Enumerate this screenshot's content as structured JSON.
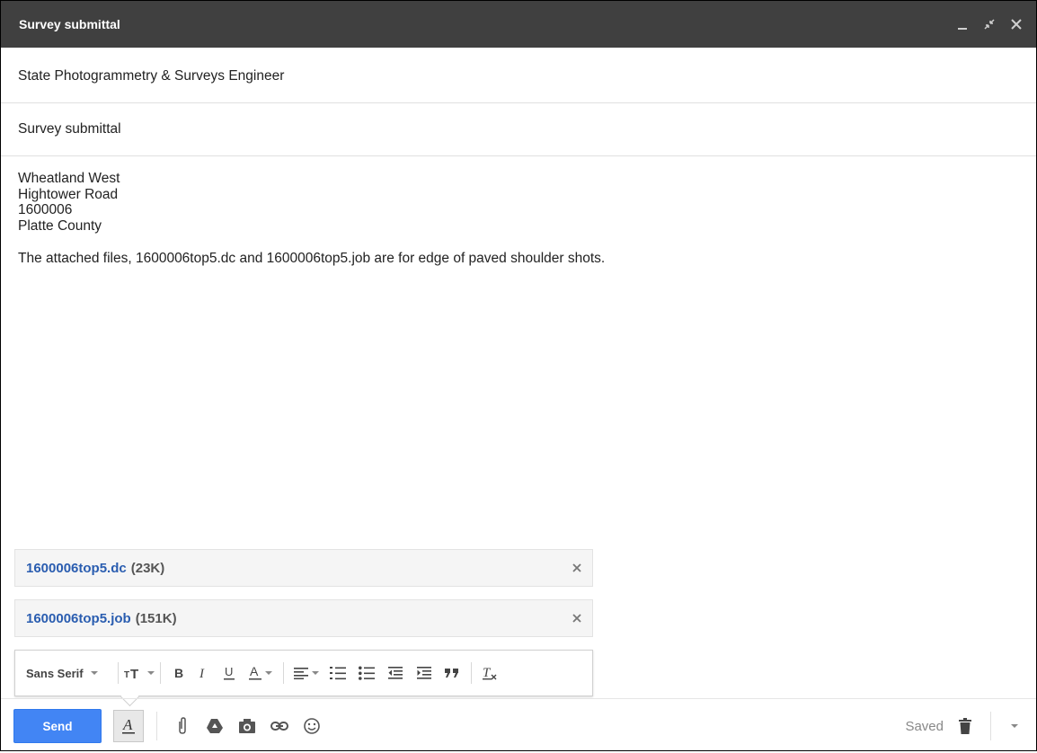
{
  "window": {
    "title": "Survey submittal"
  },
  "compose": {
    "to": "State Photogrammetry & Surveys Engineer",
    "subject": "Survey submittal",
    "body_lines": [
      "Wheatland West",
      "Hightower Road",
      "1600006",
      "Platte County"
    ],
    "body_paragraph": "The attached files, 1600006top5.dc and 1600006top5.job are for edge of paved shoulder shots."
  },
  "attachments": [
    {
      "name": "1600006top5.dc",
      "size": "(23K)"
    },
    {
      "name": "1600006top5.job",
      "size": "(151K)"
    }
  ],
  "format_toolbar": {
    "font": "Sans Serif"
  },
  "bottom_bar": {
    "send_label": "Send",
    "status": "Saved"
  },
  "colors": {
    "titlebar": "#404040",
    "send": "#4285f4",
    "link": "#2a5db0"
  }
}
